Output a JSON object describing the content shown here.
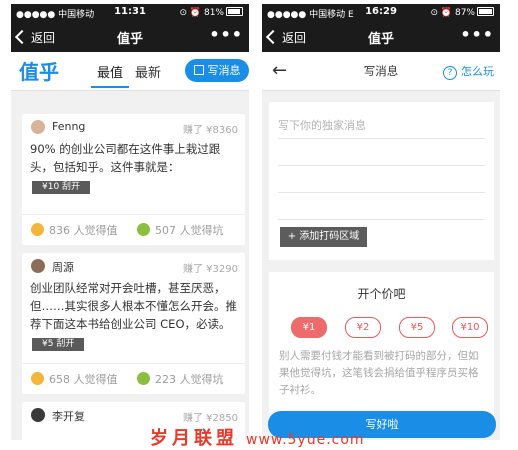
{
  "left": {
    "status": {
      "carrier": "●●●●● 中国移动",
      "time": "11:31",
      "battery": "81%"
    },
    "nav": {
      "back": "返回",
      "title": "值乎",
      "more": "•••"
    },
    "logo": "值乎",
    "tabs": [
      "最值",
      "最新"
    ],
    "write_button": "写消息",
    "posts": [
      {
        "user": "Fenng",
        "earned": "赚了 ¥8360",
        "text": "90% 的创业公司都在这件事上栽过跟头，包括知乎。这件事就是：",
        "scratch": "¥10 刮开",
        "worth": "836 人觉得值",
        "pit": "507 人觉得坑"
      },
      {
        "user": "周源",
        "earned": "赚了 ¥3290",
        "text": "创业团队经常对开会吐槽，甚至厌恶，但……其实很多人根本不懂怎么开会。推荐下面这本书给创业公司 CEO，必读。",
        "scratch": "¥5 刮开",
        "worth": "658 人觉得值",
        "pit": "223 人觉得坑"
      },
      {
        "user": "李开复",
        "earned": "赚了 ¥2850"
      }
    ]
  },
  "right": {
    "status": {
      "carrier": "●●●●● 中国移动 E",
      "time": "16:29",
      "battery": "87%"
    },
    "nav": {
      "back": "返回",
      "title": "值乎",
      "more": "•••"
    },
    "title": "写消息",
    "help": "怎么玩",
    "placeholder": "写下你的独家消息",
    "add_mask": "+ 添加打码区域",
    "price_title": "开个价吧",
    "prices": [
      "¥1",
      "¥2",
      "¥5",
      "¥10"
    ],
    "selected_price": "¥1",
    "price_desc": "别人需要付钱才能看到被打码的部分，但如果他觉得坑，这笔钱会捐给值乎程序员买格子衬衫。",
    "submit": "写好啦"
  },
  "watermark": {
    "cn": "岁月联盟",
    "url": "www.5yue.com"
  }
}
